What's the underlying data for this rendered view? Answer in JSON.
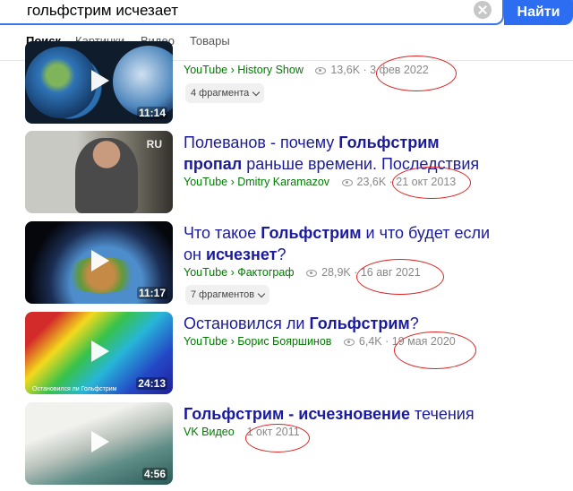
{
  "search": {
    "query": "гольфстрим исчезает",
    "button_label": "Найти"
  },
  "tabs": [
    {
      "label": "Поиск"
    },
    {
      "label": "Картинки"
    },
    {
      "label": "Видео"
    },
    {
      "label": "Товары"
    }
  ],
  "results": [
    {
      "source": "YouTube › History Show",
      "views": "13,6K",
      "date": "3 фев 2022",
      "duration": "11:14",
      "fragments": "4 фрагмента"
    },
    {
      "title_parts": [
        "Полеванов - почему ",
        "Гольфстрим",
        " ",
        "пропал",
        " раньше времени. Последствия"
      ],
      "source": "YouTube › Dmitry Karamazov",
      "views": "23,6K",
      "date": "21 окт 2013",
      "thumb_logo": "RU"
    },
    {
      "title_parts": [
        "Что такое ",
        "Гольфстрим",
        " и что будет если он ",
        "исчезнет",
        "?"
      ],
      "source": "YouTube › Фактограф",
      "views": "28,9K",
      "date": "16 авг 2021",
      "duration": "11:17",
      "fragments": "7 фрагментов"
    },
    {
      "title_parts": [
        "Остановился ли ",
        "Гольфстрим",
        "?"
      ],
      "source": "YouTube › Борис Бояршинов",
      "views": "6,4K",
      "date": "19 мая 2020",
      "duration": "24:13",
      "thumb_caption": "Остановился ли Гольфстрим"
    },
    {
      "title_parts": [
        "Гольфстрим - исчезновение",
        " течения"
      ],
      "source": "VK Видео",
      "date": "1 окт 2011",
      "duration": "4:56"
    }
  ],
  "colors": {
    "accent": "#2c6df2",
    "link": "#1a1a9f",
    "source": "#007a00",
    "annotation": "#dd2222"
  }
}
